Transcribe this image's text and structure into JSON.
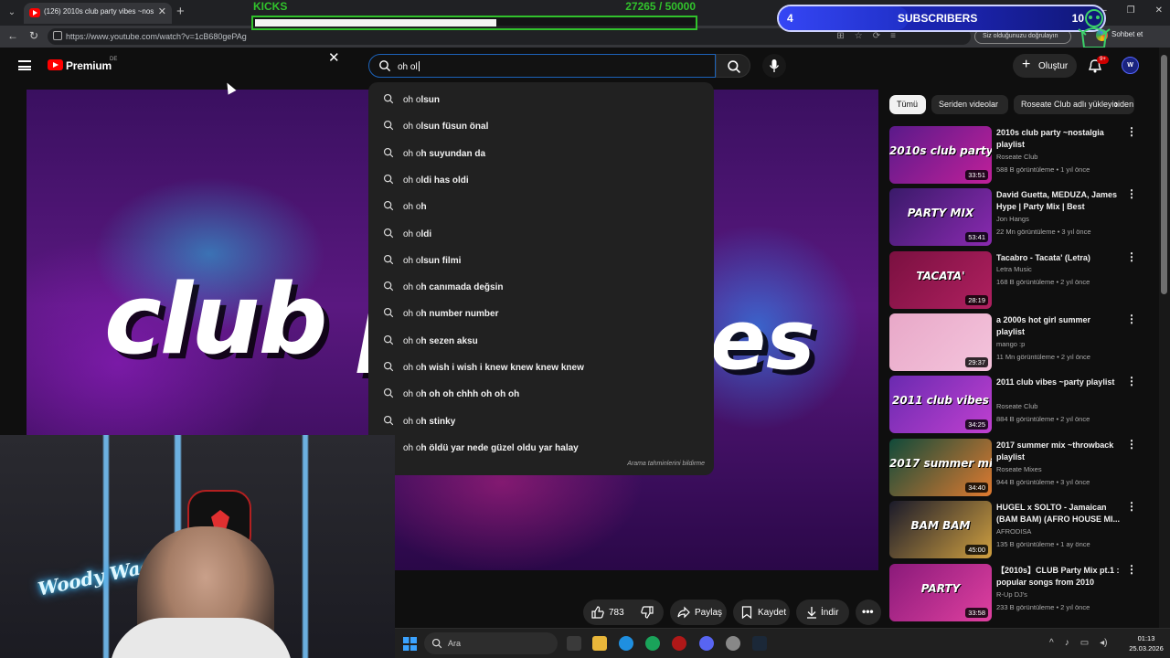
{
  "browser": {
    "tab_title": "(126) 2010s club party vibes ~nosta",
    "url": "https://www.youtube.com/watch?v=1cB680gePAg",
    "verify_chip": "Siz olduğunuzu doğrulayın",
    "chat_button": "Sohbet et"
  },
  "overlay": {
    "kicks_label": "KICKS",
    "kicks_current": "27265",
    "kicks_goal": "/ 50000",
    "kicks_progress": 0.545,
    "subs_count": "4",
    "subs_label": "SUBSCRIBERS",
    "subs_goal": "10",
    "subs_progress": 0.4
  },
  "youtube": {
    "logo_text": "Premium",
    "country_code": "DE",
    "search_value": "oh ol",
    "create_label": "Oluştur",
    "notification_count": "9+",
    "avatar_initial": "W"
  },
  "suggestions": [
    {
      "prefix": "oh o",
      "rest": "lsun"
    },
    {
      "prefix": "oh o",
      "rest": "lsun füsun önal"
    },
    {
      "prefix": "oh o",
      "rest": "h suyundan da"
    },
    {
      "prefix": "oh o",
      "rest": "ldi has oldi"
    },
    {
      "prefix": "oh o",
      "rest": "h"
    },
    {
      "prefix": "oh o",
      "rest": "ldi"
    },
    {
      "prefix": "oh o",
      "rest": "lsun filmi"
    },
    {
      "prefix": "oh o",
      "rest": "h canımada değsin"
    },
    {
      "prefix": "oh o",
      "rest": "h number number"
    },
    {
      "prefix": "oh o",
      "rest": "h sezen aksu"
    },
    {
      "prefix": "oh o",
      "rest": "h wish i wish i knew knew knew knew"
    },
    {
      "prefix": "oh o",
      "rest": "h oh oh chhh oh oh oh"
    },
    {
      "prefix": "oh o",
      "rest": "h stinky"
    },
    {
      "prefix": "oh o",
      "rest": "h öldü yar nede güzel oldu yar halay"
    }
  ],
  "suggestions_report": "Arama tahminlerini bildirme",
  "player": {
    "title_left": "club p",
    "title_right": "es"
  },
  "actions": {
    "likes": "783",
    "share": "Paylaş",
    "save": "Kaydet",
    "download": "İndir"
  },
  "chips": [
    "Tümü",
    "Seriden videolar",
    "Roseate Club adlı yükleyiciden"
  ],
  "recommendations": [
    {
      "title": "2010s club party ~nostalgia playlist",
      "channel": "Roseate Club",
      "meta": "588 B görüntüleme • 1 yıl önce",
      "duration": "33:51",
      "thumb_text": "2010s club party",
      "thumb_colors": [
        "#5a1a8a",
        "#c0209a"
      ]
    },
    {
      "title": "David Guetta, MEDUZA, James Hype | Party Mix | Best Remixe...",
      "channel": "Jon Hangs",
      "meta": "22 Mn görüntüleme • 3 yıl önce",
      "duration": "53:41",
      "thumb_text": "PARTY MIX",
      "thumb_colors": [
        "#3a1a6a",
        "#8a2ab0"
      ]
    },
    {
      "title": "Tacabro - Tacata' (Letra)",
      "channel": "Letra Music",
      "meta": "168 B görüntüleme • 2 yıl önce",
      "duration": "28:19",
      "thumb_text": "TACATA'",
      "thumb_colors": [
        "#7a1040",
        "#b02060"
      ]
    },
    {
      "title": "a 2000s hot girl summer playlist",
      "channel": "mango :p",
      "meta": "11 Mn görüntüleme • 2 yıl önce",
      "duration": "29:37",
      "thumb_text": "",
      "thumb_colors": [
        "#e8a8c8",
        "#f4c4dc"
      ]
    },
    {
      "title": "2011 club vibes ~party playlist",
      "channel": "Roseate Club",
      "meta": "884 B görüntüleme • 2 yıl önce",
      "duration": "34:25",
      "thumb_text": "2011 club vibes",
      "thumb_colors": [
        "#6a2ab0",
        "#c040d0"
      ]
    },
    {
      "title": "2017 summer mix ~throwback playlist",
      "channel": "Roseate Mixes",
      "meta": "944 B görüntüleme • 3 yıl önce",
      "duration": "34:40",
      "thumb_text": "2017 summer mix",
      "thumb_colors": [
        "#104a3a",
        "#e07a30"
      ]
    },
    {
      "title": "HUGEL x SOLTO - Jamaican (BAM BAM) (AFRO HOUSE MI...",
      "channel": "AFRODISA",
      "meta": "135 B görüntüleme • 1 ay önce",
      "duration": "45:00",
      "thumb_text": "BAM BAM",
      "thumb_colors": [
        "#1a1a2a",
        "#d0a040"
      ]
    },
    {
      "title": "【2010s】CLUB Party Mix pt.1 : popular songs from 2010",
      "channel": "R-Up DJ's",
      "meta": "233 B görüntüleme • 2 yıl önce",
      "duration": "33:58",
      "thumb_text": "PARTY",
      "thumb_colors": [
        "#8a1a7a",
        "#e040a0"
      ]
    }
  ],
  "taskbar": {
    "search_label": "Ara",
    "time": "01:13",
    "date": "25.03.2026"
  },
  "webcam": {
    "neon_text": "Woody Wacker"
  },
  "colors": {
    "youtube_red": "#ff0000",
    "kicks_green": "#31c22c",
    "search_focus": "#1c62b9",
    "subs_blue": "#1c2bcf"
  }
}
